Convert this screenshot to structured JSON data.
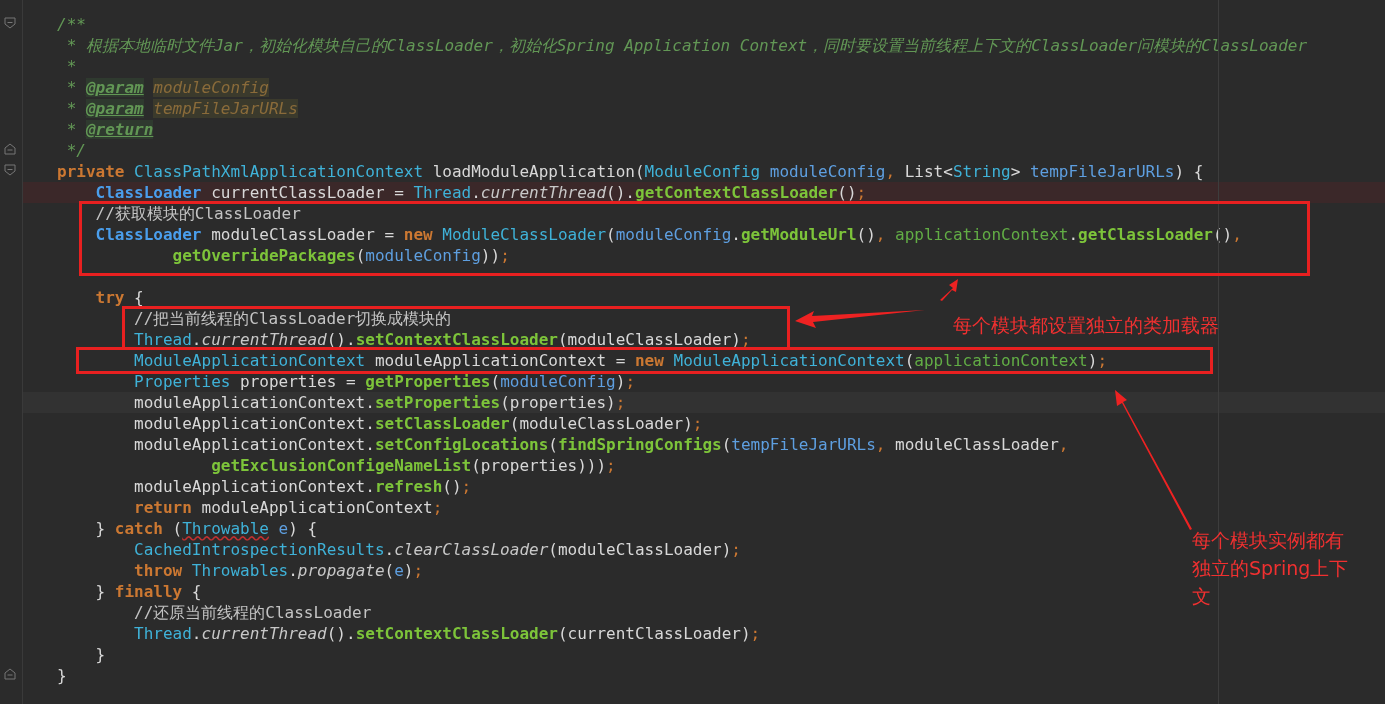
{
  "editor": {
    "lines": [
      {
        "tokens": [
          {
            "kind": "c",
            "t": "/**"
          }
        ]
      },
      {
        "tokens": [
          {
            "kind": "c",
            "t": " * 根据本地临时文件Jar，初始化模块自己的ClassLoader，初始化Spring Application Context，同时要设置当前线程上下文的ClassLoader问模块的ClassLoader"
          }
        ]
      },
      {
        "tokens": [
          {
            "kind": "c",
            "t": " *"
          }
        ]
      },
      {
        "tokens": [
          {
            "kind": "c",
            "t": " * "
          },
          {
            "kind": "tag",
            "t": "@param"
          },
          {
            "kind": "pref",
            "t": "moduleConfig"
          }
        ]
      },
      {
        "tokens": [
          {
            "kind": "c",
            "t": " * "
          },
          {
            "kind": "tag",
            "t": "@param"
          },
          {
            "kind": "pref",
            "t": "tempFileJarURLs"
          }
        ]
      },
      {
        "tokens": [
          {
            "kind": "c",
            "t": " * "
          },
          {
            "kind": "tag",
            "t": "@return"
          }
        ]
      },
      {
        "tokens": [
          {
            "kind": "c",
            "t": " */"
          }
        ]
      },
      {
        "tokens": [
          {
            "kind": "kw",
            "t": "private "
          },
          {
            "kind": "type",
            "t": "ClassPathXmlApplicationContext "
          },
          {
            "kind": "id",
            "t": "loadModuleApplication("
          },
          {
            "kind": "type",
            "t": "ModuleConfig "
          },
          {
            "kind": "par",
            "t": "moduleConfig"
          },
          {
            "kind": "semi",
            "t": ", "
          },
          {
            "kind": "id",
            "t": "List<"
          },
          {
            "kind": "type",
            "t": "String"
          },
          {
            "kind": "id",
            "t": "> "
          },
          {
            "kind": "par",
            "t": "tempFileJarURLs"
          },
          {
            "kind": "id",
            "t": ") {"
          }
        ],
        "children": [
          {
            "error": true,
            "tokens": [
              {
                "kind": "btype",
                "t": "ClassLoader "
              },
              {
                "kind": "id",
                "t": "currentClassLoader = "
              },
              {
                "kind": "type",
                "t": "Thread"
              },
              {
                "kind": "id",
                "t": "."
              },
              {
                "kind": "st",
                "t": "currentThread"
              },
              {
                "kind": "id",
                "t": "()."
              },
              {
                "kind": "fn",
                "t": "getContextClassLoader"
              },
              {
                "kind": "id",
                "t": "()"
              },
              {
                "kind": "semi",
                "t": ";"
              }
            ]
          },
          {
            "tokens": [
              {
                "kind": "lc",
                "t": "//获取模块的ClassLoader"
              }
            ]
          },
          {
            "tokens": [
              {
                "kind": "btype",
                "t": "ClassLoader "
              },
              {
                "kind": "id",
                "t": "moduleClassLoader = "
              },
              {
                "kind": "kw",
                "t": "new "
              },
              {
                "kind": "type",
                "t": "ModuleClassLoader"
              },
              {
                "kind": "id",
                "t": "("
              },
              {
                "kind": "par",
                "t": "moduleConfig"
              },
              {
                "kind": "id",
                "t": "."
              },
              {
                "kind": "fn",
                "t": "getModuleUrl"
              },
              {
                "kind": "id",
                "t": "()"
              },
              {
                "kind": "semi",
                "t": ", "
              },
              {
                "kind": "fld",
                "t": "applicationContext"
              },
              {
                "kind": "id",
                "t": "."
              },
              {
                "kind": "fn",
                "t": "getClassLoader"
              },
              {
                "kind": "id",
                "t": "()"
              },
              {
                "kind": "semi",
                "t": ","
              }
            ],
            "children": [
              {
                "continuation": true,
                "tokens": [
                  {
                    "kind": "fn",
                    "t": "getOverridePackages"
                  },
                  {
                    "kind": "id",
                    "t": "("
                  },
                  {
                    "kind": "par",
                    "t": "moduleConfig"
                  },
                  {
                    "kind": "id",
                    "t": "))"
                  },
                  {
                    "kind": "semi",
                    "t": ";"
                  }
                ]
              }
            ]
          },
          {
            "gap_before": true,
            "tokens": [
              {
                "kind": "kw",
                "t": "try "
              },
              {
                "kind": "id",
                "t": "{"
              }
            ],
            "children": [
              {
                "tokens": [
                  {
                    "kind": "lc",
                    "t": "//把当前线程的ClassLoader切换成模块的"
                  }
                ]
              },
              {
                "tokens": [
                  {
                    "kind": "type",
                    "t": "Thread"
                  },
                  {
                    "kind": "id",
                    "t": "."
                  },
                  {
                    "kind": "st",
                    "t": "currentThread"
                  },
                  {
                    "kind": "id",
                    "t": "()."
                  },
                  {
                    "kind": "fn",
                    "t": "setContextClassLoader"
                  },
                  {
                    "kind": "id",
                    "t": "(moduleClassLoader)"
                  },
                  {
                    "kind": "semi",
                    "t": ";"
                  }
                ]
              },
              {
                "tokens": [
                  {
                    "kind": "type",
                    "t": "ModuleApplicationContext "
                  },
                  {
                    "kind": "id",
                    "t": "moduleApplicationContext = "
                  },
                  {
                    "kind": "kw",
                    "t": "new "
                  },
                  {
                    "kind": "type",
                    "t": "ModuleApplicationContext"
                  },
                  {
                    "kind": "id",
                    "t": "("
                  },
                  {
                    "kind": "fld",
                    "t": "applicationContext"
                  },
                  {
                    "kind": "id",
                    "t": ")"
                  },
                  {
                    "kind": "semi",
                    "t": ";"
                  }
                ]
              },
              {
                "tokens": [
                  {
                    "kind": "type",
                    "t": "Properties "
                  },
                  {
                    "kind": "id",
                    "t": "properties = "
                  },
                  {
                    "kind": "fn",
                    "t": "getProperties"
                  },
                  {
                    "kind": "id",
                    "t": "("
                  },
                  {
                    "kind": "par",
                    "t": "moduleConfig"
                  },
                  {
                    "kind": "id",
                    "t": ")"
                  },
                  {
                    "kind": "semi",
                    "t": ";"
                  }
                ]
              },
              {
                "current": true,
                "tokens": [
                  {
                    "kind": "id",
                    "t": "moduleApplicationContext."
                  },
                  {
                    "kind": "fn",
                    "t": "setProperties"
                  },
                  {
                    "kind": "id",
                    "t": "(properties)"
                  },
                  {
                    "kind": "semi",
                    "t": ";"
                  }
                ]
              },
              {
                "tokens": [
                  {
                    "kind": "id",
                    "t": "moduleApplicationContext."
                  },
                  {
                    "kind": "fn",
                    "t": "setClassLoader"
                  },
                  {
                    "kind": "id",
                    "t": "(moduleClassLoader)"
                  },
                  {
                    "kind": "semi",
                    "t": ";"
                  }
                ]
              },
              {
                "tokens": [
                  {
                    "kind": "id",
                    "t": "moduleApplicationContext."
                  },
                  {
                    "kind": "fn",
                    "t": "setConfigLocations"
                  },
                  {
                    "kind": "id",
                    "t": "("
                  },
                  {
                    "kind": "fn",
                    "t": "findSpringConfigs"
                  },
                  {
                    "kind": "id",
                    "t": "("
                  },
                  {
                    "kind": "par",
                    "t": "tempFileJarURLs"
                  },
                  {
                    "kind": "semi",
                    "t": ", "
                  },
                  {
                    "kind": "id",
                    "t": "moduleClassLoader"
                  },
                  {
                    "kind": "semi",
                    "t": ","
                  }
                ],
                "children": [
                  {
                    "continuation": true,
                    "tokens": [
                      {
                        "kind": "fn",
                        "t": "getExclusionConfigeNameList"
                      },
                      {
                        "kind": "id",
                        "t": "(properties)))"
                      },
                      {
                        "kind": "semi",
                        "t": ";"
                      }
                    ]
                  }
                ]
              },
              {
                "tokens": [
                  {
                    "kind": "id",
                    "t": "moduleApplicationContext."
                  },
                  {
                    "kind": "fn",
                    "t": "refresh"
                  },
                  {
                    "kind": "id",
                    "t": "()"
                  },
                  {
                    "kind": "semi",
                    "t": ";"
                  }
                ]
              },
              {
                "tokens": [
                  {
                    "kind": "kw",
                    "t": "return "
                  },
                  {
                    "kind": "id",
                    "t": "moduleApplicationContext"
                  },
                  {
                    "kind": "semi",
                    "t": ";"
                  }
                ]
              }
            ]
          },
          {
            "tokens": [
              {
                "kind": "id",
                "t": "} "
              },
              {
                "kind": "kw",
                "t": "catch "
              },
              {
                "kind": "id",
                "t": "("
              },
              {
                "kind": "warn",
                "t": "Throwable"
              },
              {
                "kind": "par",
                "t": " e"
              },
              {
                "kind": "id",
                "t": ") {"
              }
            ],
            "children": [
              {
                "tokens": [
                  {
                    "kind": "type",
                    "t": "CachedIntrospectionResults"
                  },
                  {
                    "kind": "id",
                    "t": "."
                  },
                  {
                    "kind": "st",
                    "t": "clearClassLoader"
                  },
                  {
                    "kind": "id",
                    "t": "(moduleClassLoader)"
                  },
                  {
                    "kind": "semi",
                    "t": ";"
                  }
                ]
              },
              {
                "tokens": [
                  {
                    "kind": "kw",
                    "t": "throw "
                  },
                  {
                    "kind": "type",
                    "t": "Throwables"
                  },
                  {
                    "kind": "id",
                    "t": "."
                  },
                  {
                    "kind": "st",
                    "t": "propagate"
                  },
                  {
                    "kind": "id",
                    "t": "("
                  },
                  {
                    "kind": "par",
                    "t": "e"
                  },
                  {
                    "kind": "id",
                    "t": ")"
                  },
                  {
                    "kind": "semi",
                    "t": ";"
                  }
                ]
              }
            ]
          },
          {
            "tokens": [
              {
                "kind": "id",
                "t": "} "
              },
              {
                "kind": "kw",
                "t": "finally "
              },
              {
                "kind": "id",
                "t": "{"
              }
            ],
            "children": [
              {
                "tokens": [
                  {
                    "kind": "lc",
                    "t": "//还原当前线程的ClassLoader"
                  }
                ]
              },
              {
                "tokens": [
                  {
                    "kind": "type",
                    "t": "Thread"
                  },
                  {
                    "kind": "id",
                    "t": "."
                  },
                  {
                    "kind": "st",
                    "t": "currentThread"
                  },
                  {
                    "kind": "id",
                    "t": "()."
                  },
                  {
                    "kind": "fn",
                    "t": "setContextClassLoader"
                  },
                  {
                    "kind": "id",
                    "t": "(currentClassLoader)"
                  },
                  {
                    "kind": "semi",
                    "t": ";"
                  }
                ]
              }
            ]
          },
          {
            "tokens": [
              {
                "kind": "id",
                "t": "}"
              }
            ]
          }
        ]
      },
      {
        "tokens": [
          {
            "kind": "id",
            "t": "}"
          }
        ]
      }
    ]
  },
  "annotations": [
    {
      "text": "每个模块都设置独立的类加载器"
    },
    {
      "text": "每个模块实例都有独立的Spring上下文"
    }
  ]
}
